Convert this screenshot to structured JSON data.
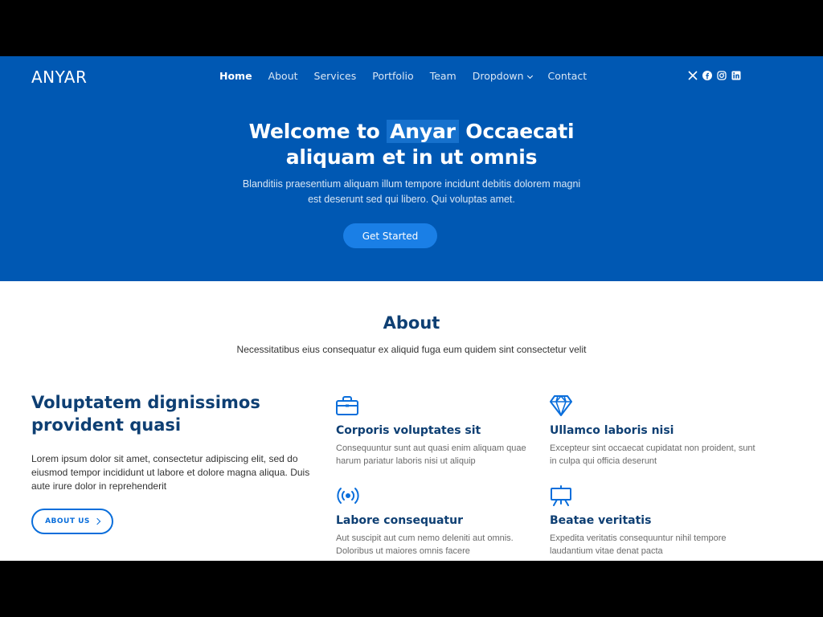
{
  "brand": "ANYAR",
  "nav": [
    {
      "label": "Home"
    },
    {
      "label": "About"
    },
    {
      "label": "Services"
    },
    {
      "label": "Portfolio"
    },
    {
      "label": "Team"
    },
    {
      "label": "Dropdown"
    },
    {
      "label": "Contact"
    }
  ],
  "socials": [
    "x-icon",
    "facebook-icon",
    "instagram-icon",
    "linkedin-icon"
  ],
  "hero": {
    "title_pre": "Welcome to",
    "title_brand": "Anyar",
    "title_line1_post": "Occaecati",
    "title_line2": "aliquam et in ut omnis",
    "subtitle_line1": "Blanditiis praesentium aliquam illum tempore incidunt debitis dolorem magni",
    "subtitle_line2": "est deserunt sed qui libero. Qui voluptas amet.",
    "cta": "Get Started"
  },
  "about": {
    "title": "About",
    "subtitle": "Necessitatibus eius consequatur ex aliquid fuga eum quidem sint consectetur velit",
    "lead_title": "Voluptatem dignissimos provident quasi",
    "lead_text": "Lorem ipsum dolor sit amet, consectetur adipiscing elit, sed do eiusmod tempor incididunt ut labore et dolore magna aliqua. Duis aute irure dolor in reprehenderit",
    "button": "ABOUT US",
    "features": [
      {
        "icon": "briefcase-icon",
        "title": "Corporis voluptates sit",
        "text": "Consequuntur sunt aut quasi enim aliquam quae harum pariatur laboris nisi ut aliquip"
      },
      {
        "icon": "gem-icon",
        "title": "Ullamco laboris nisi",
        "text": "Excepteur sint occaecat cupidatat non proident, sunt in culpa qui officia deserunt"
      },
      {
        "icon": "broadcast-icon",
        "title": "Labore consequatur",
        "text": "Aut suscipit aut cum nemo deleniti aut omnis. Doloribus ut maiores omnis facere"
      },
      {
        "icon": "easel-icon",
        "title": "Beatae veritatis",
        "text": "Expedita veritatis consequuntur nihil tempore laudantium vitae denat pacta"
      }
    ]
  },
  "colors": {
    "hero_bg": "#0058b3",
    "accent": "#0a6edb",
    "heading": "#0e3f73"
  }
}
